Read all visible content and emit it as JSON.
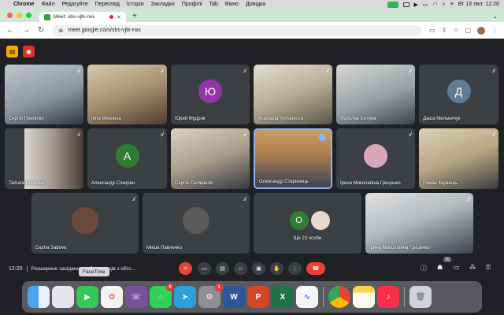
{
  "menubar": {
    "app": "Chrome",
    "items": [
      "Файл",
      "Редагуйте",
      "Перегляд",
      "Історія",
      "Закладки",
      "Профілі",
      "Tab",
      "Вікно",
      "Довідка"
    ],
    "clock": "Вт 13 лют.  12:20"
  },
  "browser": {
    "tab_title": "Meet: sbs-vjtk-rwx",
    "new_tab": "+",
    "url": "meet.google.com/sbs-vjtk-rwx"
  },
  "participants": [
    {
      "name": "Сергій Приліпко",
      "type": "video",
      "colors": [
        "#b9bfc6",
        "#3a4350"
      ]
    },
    {
      "name": "Inna Meteleva",
      "type": "video",
      "colors": [
        "#c7b59a",
        "#5b4634"
      ]
    },
    {
      "name": "Юрий Мудрик",
      "type": "avatar",
      "initial": "Ю",
      "color": "#9334a8"
    },
    {
      "name": "Anastasia Yevsiukova",
      "type": "video",
      "colors": [
        "#d6d3c5",
        "#6a6556"
      ]
    },
    {
      "name": "Ярослав Битиев",
      "type": "video",
      "colors": [
        "#c9cbc8",
        "#44484d"
      ]
    },
    {
      "name": "Даша Мельничук",
      "type": "avatar",
      "initial": "Д",
      "color": "#5f7c93"
    },
    {
      "name": "Tamara Bobkova",
      "type": "video",
      "colors": [
        "#d6d4cf",
        "#4d3d3a"
      ]
    },
    {
      "name": "Александр Сокирин",
      "type": "avatar",
      "initial": "А",
      "color": "#2e7d32"
    },
    {
      "name": "Сергій Селіванов",
      "type": "video",
      "colors": [
        "#cfc8b8",
        "#3b3f4a"
      ]
    },
    {
      "name": "Олександр Старинець",
      "type": "video",
      "colors": [
        "#c79a6a",
        "#2f3a4f"
      ]
    },
    {
      "name": "Ірина Миколаївна Гриценко",
      "type": "avatar-photo",
      "color": "#d9a5b8"
    },
    {
      "name": "Роман Корінець",
      "type": "video",
      "colors": [
        "#d4c7a8",
        "#3b3b3f"
      ]
    },
    {
      "name": "Dasha Sabova",
      "type": "avatar-photo",
      "color": "#6b4a3b"
    },
    {
      "name": "Миша Павленко",
      "type": "avatar-photo",
      "color": "#5a5a5a"
    },
    {
      "name": "Ще 23 особи",
      "type": "group",
      "initial": "О",
      "color": "#2e7d32"
    },
    {
      "name": "Ірина Миколаївна Гриценко",
      "type": "video",
      "colors": [
        "#d5d7d8",
        "#39414a"
      ]
    }
  ],
  "controls": {
    "time": "12:20",
    "meeting_title": "Розширене засідання роботодавців з обго...",
    "participants_count": "26"
  },
  "dock": {
    "tooltip": "FaceTime",
    "apps": [
      {
        "name": "Finder",
        "color": "#3a8ee6"
      },
      {
        "name": "Launchpad",
        "color": "#e5e5ea"
      },
      {
        "name": "FaceTime",
        "color": "#34c759"
      },
      {
        "name": "Photos",
        "color": "#f2f2f2"
      },
      {
        "name": "Viber",
        "color": "#7b519d"
      },
      {
        "name": "Messages",
        "color": "#30d158",
        "badge": "6"
      },
      {
        "name": "Telegram",
        "color": "#2aa1da"
      },
      {
        "name": "Settings",
        "color": "#8e8e93",
        "badge": "1"
      },
      {
        "name": "Word",
        "color": "#2b579a"
      },
      {
        "name": "PowerPoint",
        "color": "#d24726"
      },
      {
        "name": "Excel",
        "color": "#217346"
      },
      {
        "name": "Freeform",
        "color": "#f5f5f5"
      },
      {
        "name": "Chrome",
        "color": "#f2f2f2"
      },
      {
        "name": "Notes",
        "color": "#fcd34d"
      },
      {
        "name": "Music",
        "color": "#fa2d48"
      },
      {
        "name": "Trash",
        "color": "#d0d3d6"
      }
    ]
  }
}
